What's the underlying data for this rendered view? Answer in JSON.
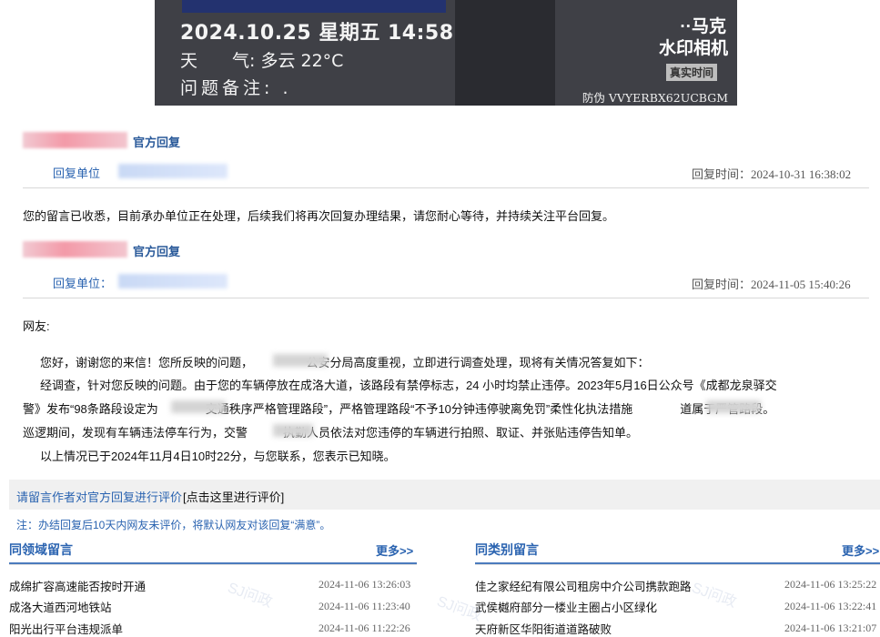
{
  "photo": {
    "datetime": "2024.10.25 星期五 14:58",
    "weather": "天　　气: 多云 22°C",
    "note": "问题备注: .",
    "logo_line1": "··马克",
    "logo_line2": "水印相机",
    "realtime_badge": "真实时间",
    "anti_fake": "防伪 VVYERBX62UCBGM"
  },
  "replies": [
    {
      "official_label": "官方回复",
      "unit_label": "回复单位",
      "time": "回复时间：2024-10-31 16:38:02",
      "body": "您的留言已收悉，目前承办单位正在处理，后续我们将再次回复办理结果，请您耐心等待，并持续关注平台回复。"
    },
    {
      "official_label": "官方回复",
      "unit_label": "回复单位：",
      "time": "回复时间：2024-11-05 15:40:26",
      "greeting": "网友:",
      "p1": "您好，谢谢您的来信！您所反映的问题，　　　　　公安分局高度重视，立即进行调查处理，现将有关情况答复如下：",
      "p2a": "经调查，针对您反映的问题。由于您的车辆停放在成洛大道，该路段有禁停标志，24 小时均禁止违停。2023年5月16日公众号《成都龙泉驿交",
      "p2b": "警》发布“98条路段设定为　　　　交通秩序严格管理路段”，严格管理路段“不予10分钟违停驶离免罚”柔性化执法措施　　　　道属于严管路段。",
      "p2c": "巡逻期间，发现有车辆违法停车行为，交警　　　执勤人员依法对您违停的车辆进行拍照、取证、并张贴违停告知单。",
      "p3": "以上情况已于2024年11月4日10时22分，与您联系，您表示已知晓。"
    }
  ],
  "evaluation": {
    "prompt": "请留言作者对官方回复进行评价",
    "link": "[点击这里进行评价]",
    "note": "注：办结回复后10天内网友未评价，将默认网友对该回复“满意”。"
  },
  "same_field": {
    "title": "同领域留言",
    "more": "更多>>",
    "items": [
      {
        "title": "成绵扩容高速能否按时开通",
        "time": "2024-11-06 13:26:03"
      },
      {
        "title": "成洛大道西河地铁站",
        "time": "2024-11-06 11:23:40"
      },
      {
        "title": "阳光出行平台违规派单",
        "time": "2024-11-06 11:22:26"
      }
    ]
  },
  "same_category": {
    "title": "同类别留言",
    "more": "更多>>",
    "items": [
      {
        "title": "佳之家经纪有限公司租房中介公司携款跑路",
        "time": "2024-11-06 13:25:22"
      },
      {
        "title": "武侯樾府部分一楼业主圈占小区绿化",
        "time": "2024-11-06 13:22:41"
      },
      {
        "title": "天府新区华阳街道道路破败",
        "time": "2024-11-06 13:21:07"
      }
    ]
  },
  "watermark": "SJ问政"
}
